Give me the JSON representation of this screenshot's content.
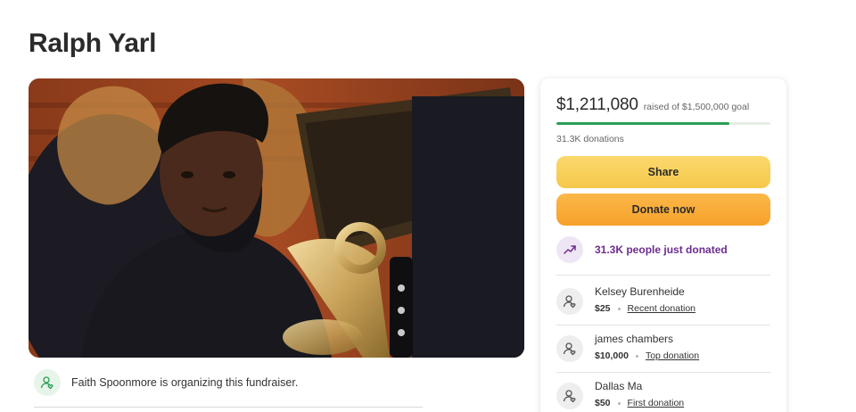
{
  "campaign": {
    "title": "Ralph Yarl"
  },
  "organizer": {
    "text": "Faith Spoonmore is organizing this fundraiser.",
    "icon": "person-heart-icon"
  },
  "progress": {
    "raised": "$1,211,080",
    "goal_text": "raised of $1,500,000 goal",
    "fraction": 0.807,
    "donations": "31.3K donations"
  },
  "buttons": {
    "share": "Share",
    "donate": "Donate now"
  },
  "trend": {
    "text": "31.3K people just donated",
    "icon": "trending-up-icon"
  },
  "donors": [
    {
      "name": "Kelsey Burenheide",
      "amount": "$25",
      "tag": "Recent donation"
    },
    {
      "name": "james chambers",
      "amount": "$10,000",
      "tag": "Top donation"
    },
    {
      "name": "Dallas Ma",
      "amount": "$50",
      "tag": "First donation"
    }
  ],
  "colors": {
    "accent_green": "#2a9d53",
    "share_yellow": "#f5c84a",
    "donate_orange": "#f6a12a",
    "trend_purple": "#6b2d8e"
  }
}
